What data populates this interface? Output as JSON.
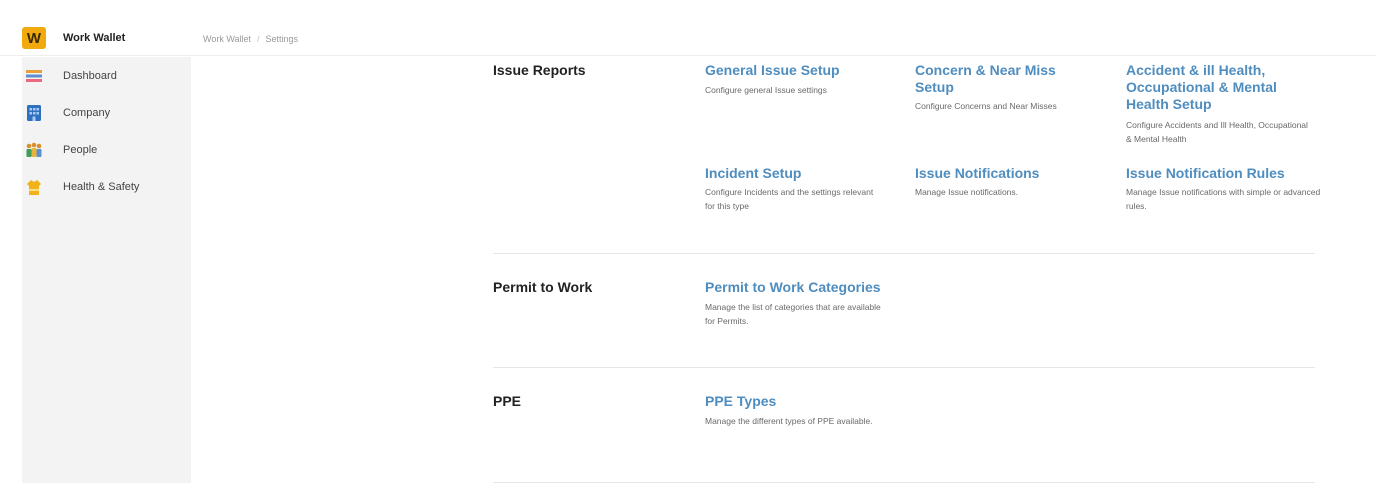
{
  "app": {
    "name": "Work Wallet",
    "logo_letter": "W",
    "accent": "#f1a90e",
    "link_color": "#4f8dbf"
  },
  "breadcrumb": {
    "root": "Work Wallet",
    "separator": "/",
    "current": "Settings"
  },
  "sidebar": {
    "items": [
      {
        "label": "Dashboard",
        "icon": "dashboard-icon"
      },
      {
        "label": "Company",
        "icon": "building-icon"
      },
      {
        "label": "People",
        "icon": "people-icon"
      },
      {
        "label": "Health & Safety",
        "icon": "health-safety-icon"
      }
    ]
  },
  "sections": {
    "issue_reports": {
      "title": "Issue Reports",
      "cards": [
        {
          "title": "General Issue Setup",
          "desc": "Configure general Issue settings"
        },
        {
          "title": "Concern & Near Miss Setup",
          "desc": "Configure Concerns and Near Misses"
        },
        {
          "title": "Accident & ill Health, Occupational & Mental Health Setup",
          "desc": "Configure Accidents and Ill Health, Occupational & Mental Health"
        },
        {
          "title": "Incident Setup",
          "desc": "Configure Incidents and the settings relevant for this type"
        },
        {
          "title": "Issue Notifications",
          "desc": "Manage Issue notifications."
        },
        {
          "title": "Issue Notification Rules",
          "desc": "Manage Issue notifications with simple or advanced rules."
        }
      ]
    },
    "permit_to_work": {
      "title": "Permit to Work",
      "cards": [
        {
          "title": "Permit to Work Categories",
          "desc": "Manage the list of categories that are available for Permits."
        }
      ]
    },
    "ppe": {
      "title": "PPE",
      "cards": [
        {
          "title": "PPE Types",
          "desc": "Manage the different types of PPE available."
        }
      ]
    }
  }
}
